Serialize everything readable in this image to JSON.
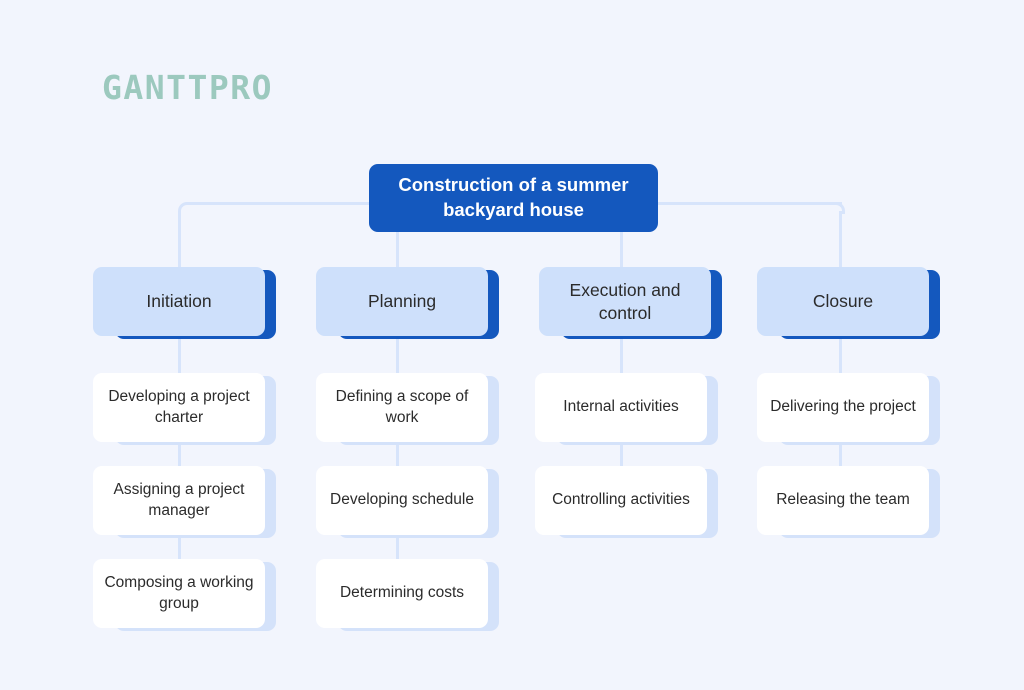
{
  "branding": {
    "logo_text": "GANTTPRO",
    "logo_color": "#9CC9BE"
  },
  "theme": {
    "background": "#F2F5FD",
    "root_fill": "#1458BE",
    "root_text": "#FFFFFF",
    "phase_fill": "#CEE0FB",
    "phase_accent": "#1458BE",
    "task_fill": "#FFFFFF",
    "task_accent": "#D4E2FA",
    "connector": "#D7E4FB",
    "node_text": "#2B2B2B"
  },
  "diagram": {
    "type": "work-breakdown-structure",
    "root": {
      "label": "Construction of a summer backyard house"
    },
    "phases": [
      {
        "label": "Initiation",
        "tasks": [
          {
            "label": "Developing a project charter"
          },
          {
            "label": "Assigning a project manager"
          },
          {
            "label": "Composing a working group"
          }
        ]
      },
      {
        "label": "Planning",
        "tasks": [
          {
            "label": "Defining a scope of work"
          },
          {
            "label": "Developing schedule"
          },
          {
            "label": "Determining costs"
          }
        ]
      },
      {
        "label": "Execution and control",
        "tasks": [
          {
            "label": "Internal activities"
          },
          {
            "label": "Controlling activities"
          }
        ]
      },
      {
        "label": "Closure",
        "tasks": [
          {
            "label": "Delivering the project"
          },
          {
            "label": "Releasing the team"
          }
        ]
      }
    ]
  }
}
